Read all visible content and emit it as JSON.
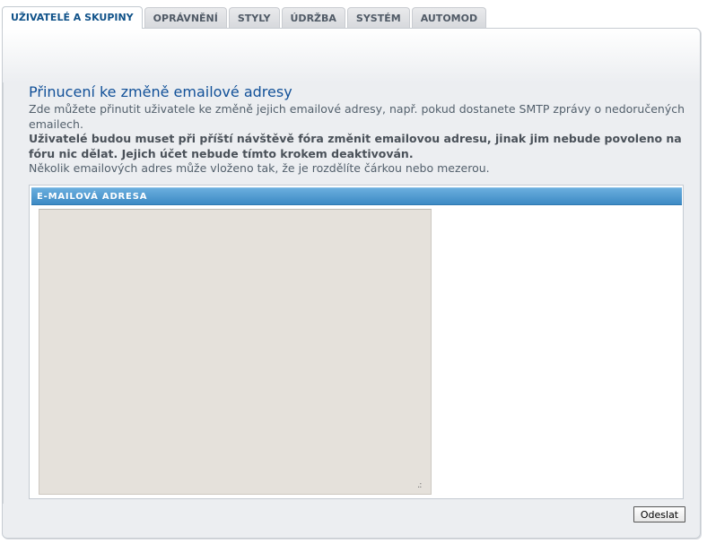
{
  "tabs": [
    {
      "label": "UŽIVATELÉ A SKUPINY",
      "active": true
    },
    {
      "label": "OPRÁVNĚNÍ",
      "active": false
    },
    {
      "label": "STYLY",
      "active": false
    },
    {
      "label": "ÚDRŽBA",
      "active": false
    },
    {
      "label": "SYSTÉM",
      "active": false
    },
    {
      "label": "AUTOMOD",
      "active": false
    }
  ],
  "main": {
    "title": "Přinucení ke změně emailové adresy",
    "description_1": "Zde můžete přinutit uživatele ke změně jejich emailové adresy, např. pokud dostanete SMTP zprávy o nedoručených emailech.",
    "description_bold": "Uživatelé budou muset při příští návštěvě fóra změnit emailovou adresu, jinak jim nebude povoleno na fóru nic dělat. Jejich účet nebude tímto krokem deaktivován.",
    "description_2": "Několik emailových adres může vloženo tak, že je rozdělíte čárkou nebo mezerou.",
    "field_header": "E-MAILOVÁ ADRESA",
    "field_value": "",
    "submit_label": "Odeslat"
  },
  "colors": {
    "title": "#115098",
    "header_bar": "#4b95cd",
    "textarea_bg": "#e5e1db",
    "active_tab_text": "#105289"
  }
}
